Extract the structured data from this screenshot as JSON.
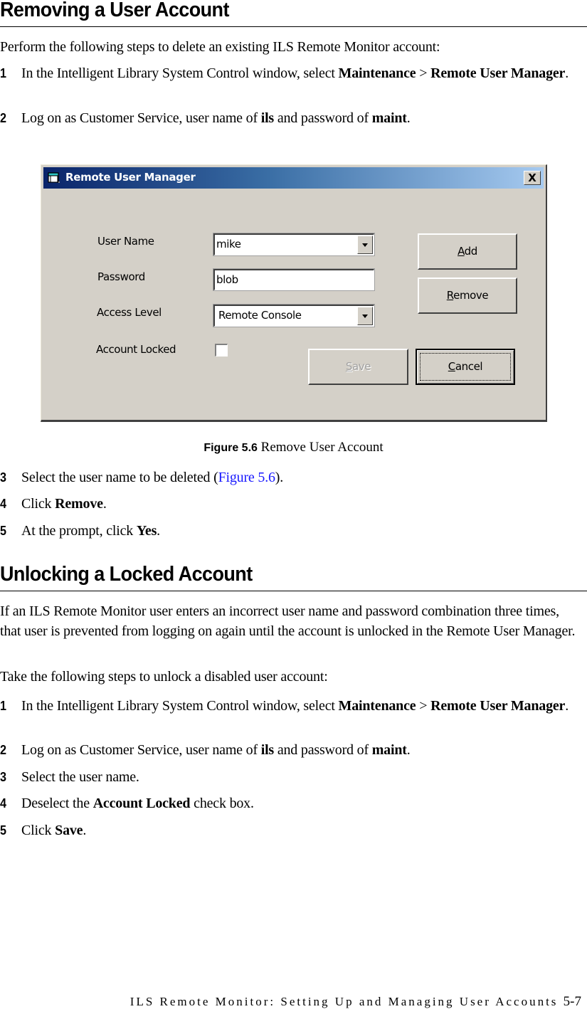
{
  "section1": {
    "heading": "Removing a User Account",
    "intro": "Perform the following steps to delete an existing ILS Remote Monitor account:",
    "steps": [
      {
        "num": "1",
        "pre": "In the Intelligent Library System Control window, select ",
        "bold1": "Maintenance",
        "mid": " > ",
        "bold2": "Remote User Manager",
        "post": "."
      },
      {
        "num": "2",
        "pre": "Log on as Customer Service, user name of ",
        "bold1": "ils",
        "mid": " and password of ",
        "bold2": "maint",
        "post": "."
      }
    ]
  },
  "figure": {
    "dialog": {
      "title": "Remote User Manager",
      "close_label": "X",
      "fields": {
        "user_name_label": "User Name",
        "user_name_value": "mike",
        "password_label": "Password",
        "password_value": "blob",
        "access_level_label": "Access Level",
        "access_level_value": "Remote Console",
        "account_locked_label": "Account Locked",
        "account_locked_checked": false
      },
      "buttons": {
        "add": {
          "mnemonic": "A",
          "rest": "dd"
        },
        "remove": {
          "mnemonic": "R",
          "rest": "emove"
        },
        "save": {
          "mnemonic": "S",
          "rest": "ave",
          "disabled": true
        },
        "cancel": {
          "mnemonic": "C",
          "rest": "ancel",
          "default": true
        }
      }
    },
    "caption_label": "Figure 5.6",
    "caption_text": " Remove User Account"
  },
  "section1_more_steps": [
    {
      "num": "3",
      "pre": "Select the user name to be deleted (",
      "link": "Figure 5.6",
      "post": ")."
    },
    {
      "num": "4",
      "pre": "Click ",
      "bold1": "Remove",
      "post": "."
    },
    {
      "num": "5",
      "pre": "At the prompt, click ",
      "bold1": "Yes",
      "post": "."
    }
  ],
  "section2": {
    "heading": "Unlocking a Locked Account",
    "para1": "If an ILS Remote Monitor user enters an incorrect user name and password combination three times, that user is prevented from logging on again until the account is unlocked in the Remote User Manager.",
    "para2": "Take the following steps to unlock a disabled user account:",
    "steps": [
      {
        "num": "1",
        "pre": "In the Intelligent Library System Control window, select ",
        "bold1": "Maintenance",
        "mid": " > ",
        "bold2": "Remote User Manager",
        "post": "."
      },
      {
        "num": "2",
        "pre": "Log on as Customer Service, user name of ",
        "bold1": "ils",
        "mid": " and password of ",
        "bold2": "maint",
        "post": "."
      },
      {
        "num": "3",
        "pre": "Select the user name."
      },
      {
        "num": "4",
        "pre": "Deselect the ",
        "bold1": "Account Locked",
        "post": " check box."
      },
      {
        "num": "5",
        "pre": "Click ",
        "bold1": "Save",
        "post": "."
      }
    ]
  },
  "footer": {
    "running_title": "ILS Remote Monitor: Setting Up and Managing User Accounts",
    "page_number": "5-7"
  }
}
